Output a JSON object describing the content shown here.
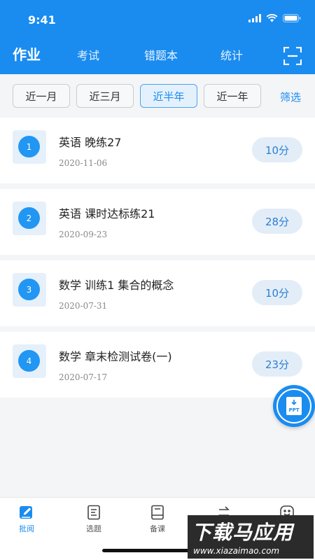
{
  "status": {
    "time": "9:41"
  },
  "nav": {
    "tabs": [
      {
        "label": "作业",
        "active": true
      },
      {
        "label": "考试",
        "active": false
      },
      {
        "label": "错题本",
        "active": false
      },
      {
        "label": "统计",
        "active": false
      }
    ],
    "scan_icon": "scan-icon"
  },
  "filters": {
    "chips": [
      {
        "label": "近一月",
        "active": false
      },
      {
        "label": "近三月",
        "active": false
      },
      {
        "label": "近半年",
        "active": true
      },
      {
        "label": "近一年",
        "active": false
      }
    ],
    "filter_label": "筛选"
  },
  "assignments": [
    {
      "index": "1",
      "title": "英语  晚练27",
      "date": "2020-11-06",
      "score": "10分"
    },
    {
      "index": "2",
      "title": "英语  课时达标练21",
      "date": "2020-09-23",
      "score": "28分"
    },
    {
      "index": "3",
      "title": "数学  训练1    集合的概念",
      "date": "2020-07-31",
      "score": "10分"
    },
    {
      "index": "4",
      "title": "数学  章末检测试卷(一)",
      "date": "2020-07-17",
      "score": "23分"
    }
  ],
  "fab": {
    "label": "PPT"
  },
  "tabbar": {
    "items": [
      {
        "label": "批阅",
        "icon": "edit-icon",
        "active": true
      },
      {
        "label": "选题",
        "icon": "document-icon",
        "active": false
      },
      {
        "label": "备课",
        "icon": "book-icon",
        "active": false
      },
      {
        "label": "",
        "icon": "swap-icon",
        "active": false
      },
      {
        "label": "",
        "icon": "smile-icon",
        "active": false
      }
    ]
  },
  "watermark": {
    "main": "下载马应用",
    "url": "www.xiazaimao.com"
  },
  "colors": {
    "primary": "#1a8cf0",
    "badge": "#2196f3",
    "pill_bg": "#e3edf8"
  }
}
